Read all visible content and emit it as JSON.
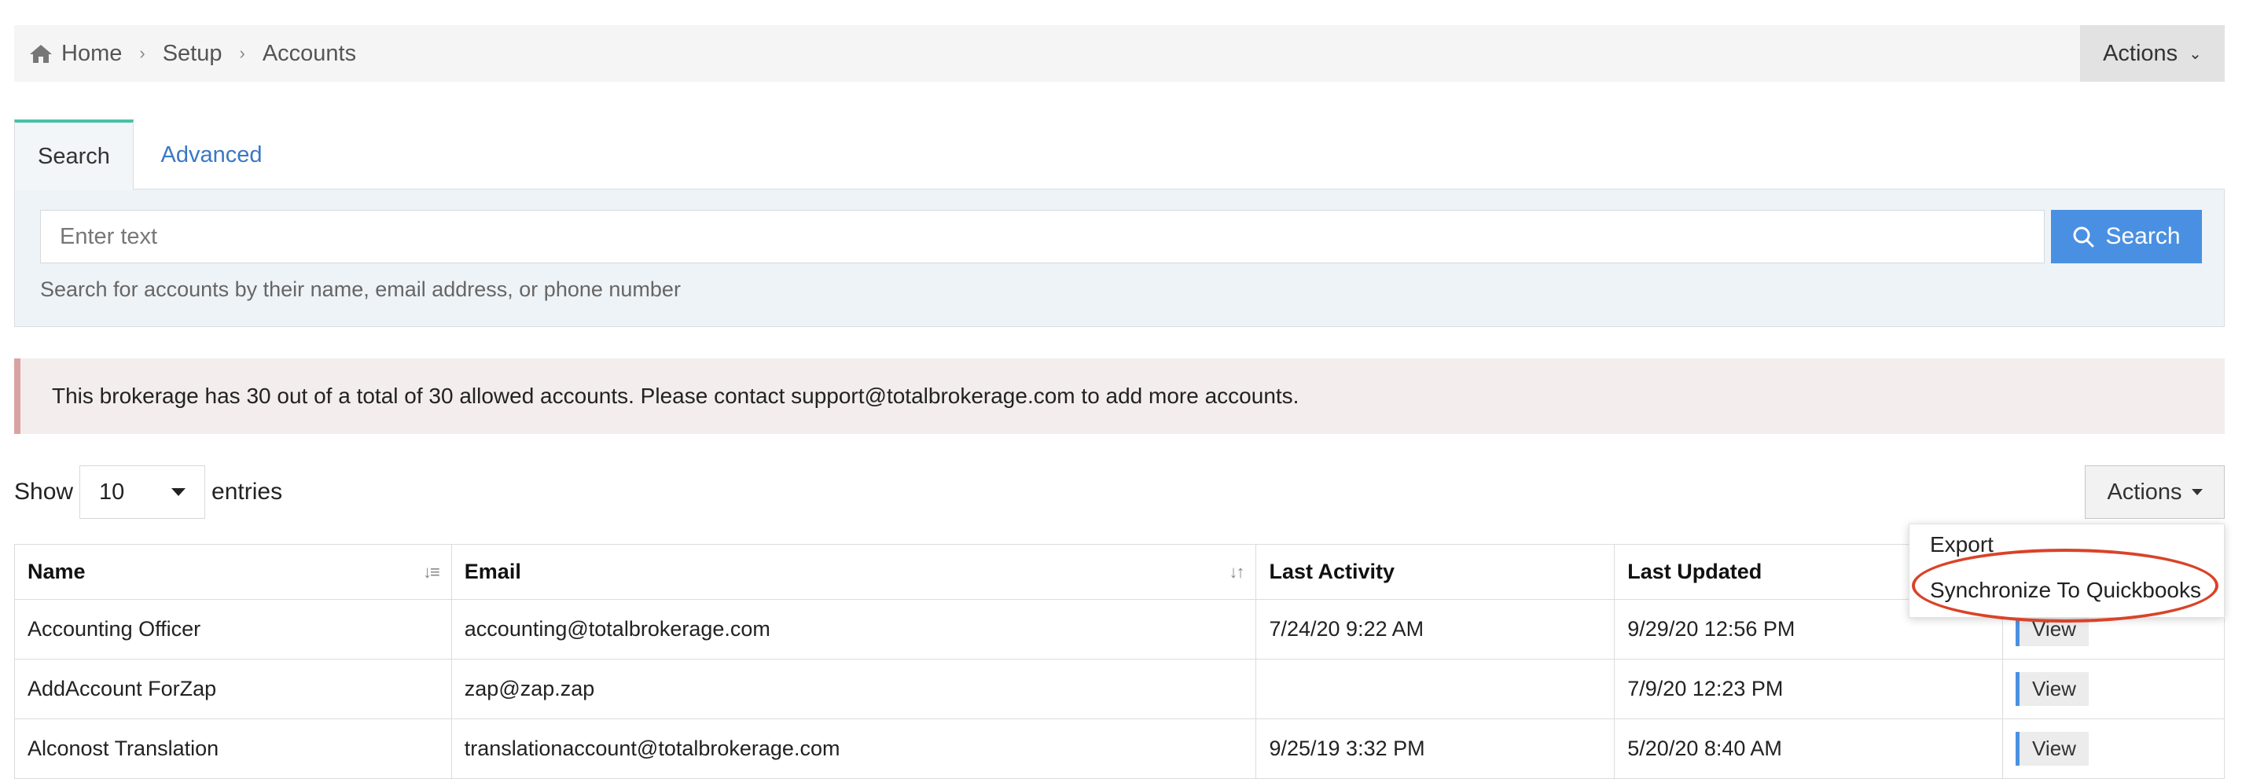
{
  "breadcrumb": {
    "items": [
      {
        "label": "Home",
        "icon": "home-icon"
      },
      {
        "label": "Setup"
      },
      {
        "label": "Accounts"
      }
    ],
    "actions_label": "Actions"
  },
  "tabs": [
    {
      "label": "Search",
      "active": true
    },
    {
      "label": "Advanced",
      "active": false
    }
  ],
  "search": {
    "placeholder": "Enter text",
    "button_label": "Search",
    "help_text": "Search for accounts by their name, email address, or phone number"
  },
  "alert": {
    "text": "This brokerage has 30 out of a total of 30 allowed accounts. Please contact support@totalbrokerage.com to add more accounts."
  },
  "entries": {
    "show_label": "Show",
    "value": "10",
    "suffix_label": "entries"
  },
  "table_actions": {
    "label": "Actions",
    "menu": [
      "Export",
      "Synchronize To Quickbooks"
    ]
  },
  "table": {
    "columns": [
      "Name",
      "Email",
      "Last Activity",
      "Last Updated",
      ""
    ],
    "rows": [
      {
        "name": "Accounting Officer",
        "email": "accounting@totalbrokerage.com",
        "last_activity": "7/24/20 9:22 AM",
        "last_updated": "9/29/20 12:56 PM",
        "action": "View"
      },
      {
        "name": "AddAccount ForZap",
        "email": "zap@zap.zap",
        "last_activity": "",
        "last_updated": "7/9/20 12:23 PM",
        "action": "View"
      },
      {
        "name": "Alconost Translation",
        "email": "translationaccount@totalbrokerage.com",
        "last_activity": "9/25/19 3:32 PM",
        "last_updated": "5/20/20 8:40 AM",
        "action": "View"
      }
    ]
  },
  "colors": {
    "accent_blue": "#4a90e2",
    "link_blue": "#3a78c3",
    "tab_accent": "#47c1a8",
    "alert_bg": "#f4eded",
    "highlight_red": "#d94328"
  }
}
